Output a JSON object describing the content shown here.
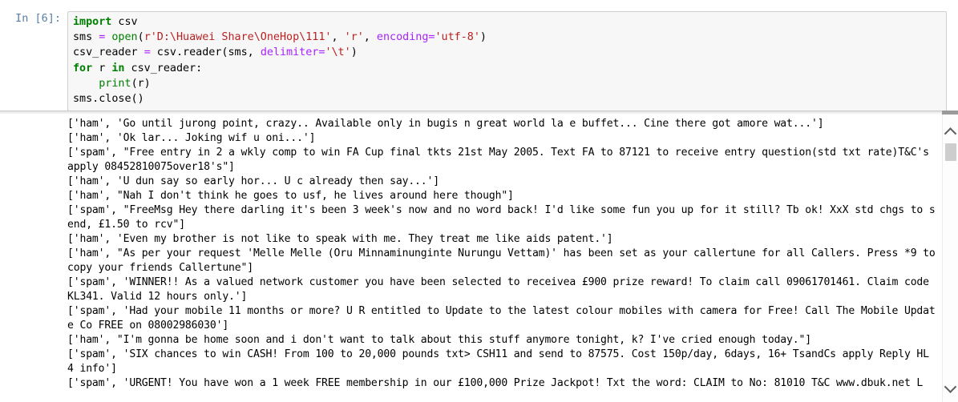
{
  "notebook": {
    "prompt": {
      "in_label": "In [6]:"
    },
    "code_cell": {
      "language": "python",
      "lines": [
        "import csv",
        "sms = open(r'D:\\Huawei Share\\OneHop\\111', 'r', encoding='utf-8')",
        "csv_reader = csv.reader(sms, delimiter='\\t')",
        "for r in csv_reader:",
        "    print(r)",
        "sms.close()"
      ]
    },
    "output": {
      "lines": [
        "['ham', 'Go until jurong point, crazy.. Available only in bugis n great world la e buffet... Cine there got amore wat...']",
        "['ham', 'Ok lar... Joking wif u oni...']",
        "['spam', \"Free entry in 2 a wkly comp to win FA Cup final tkts 21st May 2005. Text FA to 87121 to receive entry question(std txt rate)T&C's apply 08452810075over18's\"]",
        "['ham', 'U dun say so early hor... U c already then say...']",
        "['ham', \"Nah I don't think he goes to usf, he lives around here though\"]",
        "['spam', \"FreeMsg Hey there darling it's been 3 week's now and no word back! I'd like some fun you up for it still? Tb ok! XxX std chgs to send, £1.50 to rcv\"]",
        "['ham', 'Even my brother is not like to speak with me. They treat me like aids patent.']",
        "['ham', \"As per your request 'Melle Melle (Oru Minnaminunginte Nurungu Vettam)' has been set as your callertune for all Callers. Press *9 to copy your friends Callertune\"]",
        "['spam', 'WINNER!! As a valued network customer you have been selected to receivea £900 prize reward! To claim call 09061701461. Claim code KL341. Valid 12 hours only.']",
        "['spam', 'Had your mobile 11 months or more? U R entitled to Update to the latest colour mobiles with camera for Free! Call The Mobile Update Co FREE on 08002986030']",
        "['ham', \"I'm gonna be home soon and i don't want to talk about this stuff anymore tonight, k? I've cried enough today.\"]",
        "['spam', 'SIX chances to win CASH! From 100 to 20,000 pounds txt> CSH11 and send to 87575. Cost 150p/day, 6days, 16+ TsandCs apply Reply HL 4 info']",
        "['spam', 'URGENT! You have won a 1 week FREE membership in our £100,000 Prize Jackpot! Txt the word: CLAIM to No: 81010 T&C www.dbuk.net L"
      ]
    },
    "scrollbar": {
      "up_arrow_icon": "chevron-up-icon",
      "down_arrow_icon": "chevron-down-icon"
    }
  },
  "colors": {
    "prompt": "#587fa5",
    "keyword": "#008000",
    "builtin": "#008000",
    "string": "#ba2121",
    "operator": "#aa22ff",
    "cell_background": "#f7f7f7",
    "cell_border": "#cfcfcf",
    "page_background": "#ffffff",
    "scroll_thumb": "#cdcdcd"
  }
}
